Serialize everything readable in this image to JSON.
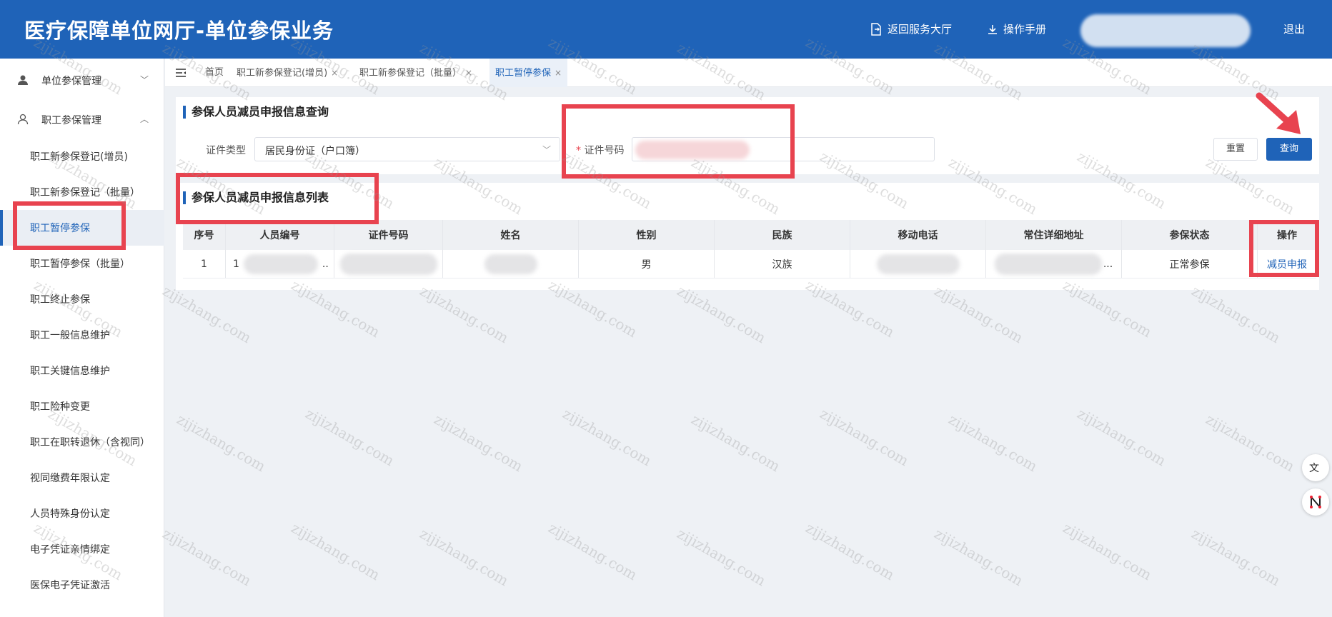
{
  "header": {
    "title": "医疗保障单位网厅-单位参保业务",
    "back_label": "返回服务大厅",
    "manual_label": "操作手册",
    "logout_label": "退出"
  },
  "sidebar": {
    "groups": [
      {
        "label": "单位参保管理",
        "expanded": false
      },
      {
        "label": "职工参保管理",
        "expanded": true
      }
    ],
    "items": [
      {
        "label": "职工新参保登记(增员)"
      },
      {
        "label": "职工新参保登记（批量）"
      },
      {
        "label": "职工暂停参保",
        "active": true
      },
      {
        "label": "职工暂停参保（批量）"
      },
      {
        "label": "职工终止参保"
      },
      {
        "label": "职工一般信息维护"
      },
      {
        "label": "职工关键信息维护"
      },
      {
        "label": "职工险种变更"
      },
      {
        "label": "职工在职转退休（含视同）"
      },
      {
        "label": "视同缴费年限认定"
      },
      {
        "label": "人员特殊身份认定"
      },
      {
        "label": "电子凭证亲情绑定"
      },
      {
        "label": "医保电子凭证激活"
      }
    ]
  },
  "tabs": [
    {
      "label": "首页",
      "closable": false
    },
    {
      "label": "职工新参保登记(增员)",
      "closable": true
    },
    {
      "label": "职工新参保登记（批量）",
      "closable": true
    },
    {
      "label": "职工暂停参保",
      "closable": true,
      "active": true
    }
  ],
  "close_glyph": "×",
  "query": {
    "title": "参保人员减员申报信息查询",
    "id_type_label": "证件类型",
    "id_type_value": "居民身份证（户口簿）",
    "id_number_label": "证件号码",
    "required_mark": "*",
    "reset_label": "重置",
    "search_label": "查询"
  },
  "list": {
    "title": "参保人员减员申报信息列表",
    "columns": [
      "序号",
      "人员编号",
      "证件号码",
      "姓名",
      "性别",
      "民族",
      "移动电话",
      "常住详细地址",
      "参保状态",
      "操作"
    ],
    "rows": [
      {
        "index": "1",
        "person_no_prefix": "1",
        "person_no_suffix": "..",
        "gender": "男",
        "ethnicity": "汉族",
        "address_suffix": "...",
        "status": "正常参保",
        "action": "减员申报"
      }
    ]
  },
  "watermark": "zijizhang.com",
  "colors": {
    "primary": "#1f63b8",
    "annotation_red": "#e8434f"
  }
}
